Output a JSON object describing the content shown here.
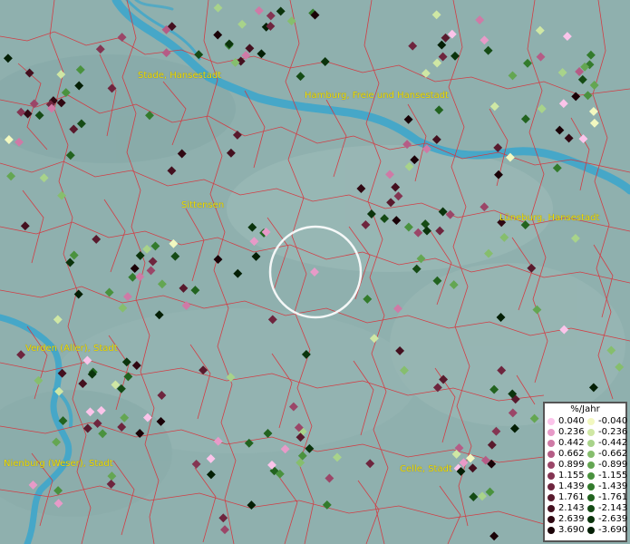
{
  "map": {
    "cities": [
      {
        "key": "stade",
        "label": "Stade, Hansestadt"
      },
      {
        "key": "hamburg",
        "label": "Hamburg, Freie und Hansestadt"
      },
      {
        "key": "sittensen",
        "label": "Sittensen"
      },
      {
        "key": "lueneburg",
        "label": "Lüneburg, Hansestadt"
      },
      {
        "key": "verden",
        "label": "Verden (Aller), Stadt"
      },
      {
        "key": "nienburg",
        "label": "Nienburg (Weser), Stadt"
      },
      {
        "key": "celle",
        "label": "Celle, Stadt"
      }
    ],
    "colors": {
      "base": "#8fb0ae",
      "water": "#3aa6cc",
      "borders": "#d8323a",
      "label": "#f0e000",
      "highlight_ring": "#ffffff"
    }
  },
  "legend": {
    "title": "%/Jahr",
    "positive": [
      {
        "value": "0.040",
        "color": "#fbc4ea"
      },
      {
        "value": "0.236",
        "color": "#e79ac8"
      },
      {
        "value": "0.442",
        "color": "#cf7aa6"
      },
      {
        "value": "0.662",
        "color": "#b55c86"
      },
      {
        "value": "0.899",
        "color": "#9b4668"
      },
      {
        "value": "1.155",
        "color": "#843552"
      },
      {
        "value": "1.439",
        "color": "#6e253e"
      },
      {
        "value": "1.761",
        "color": "#591a2d"
      },
      {
        "value": "2.143",
        "color": "#44101f"
      },
      {
        "value": "2.639",
        "color": "#300812"
      },
      {
        "value": "3.690",
        "color": "#1a0207"
      }
    ],
    "negative": [
      {
        "value": "-0.040",
        "color": "#f2f8c0"
      },
      {
        "value": "-0.236",
        "color": "#cfe7a4"
      },
      {
        "value": "-0.442",
        "color": "#a8d38a"
      },
      {
        "value": "-0.662",
        "color": "#86be6d"
      },
      {
        "value": "-0.899",
        "color": "#64a652"
      },
      {
        "value": "-1.155",
        "color": "#4a923e"
      },
      {
        "value": "-1.439",
        "color": "#337b2c"
      },
      {
        "value": "-1.761",
        "color": "#22631f"
      },
      {
        "value": "-2.143",
        "color": "#154b15"
      },
      {
        "value": "-2.639",
        "color": "#0b340c"
      },
      {
        "value": "-3.690",
        "color": "#041f05"
      }
    ]
  }
}
